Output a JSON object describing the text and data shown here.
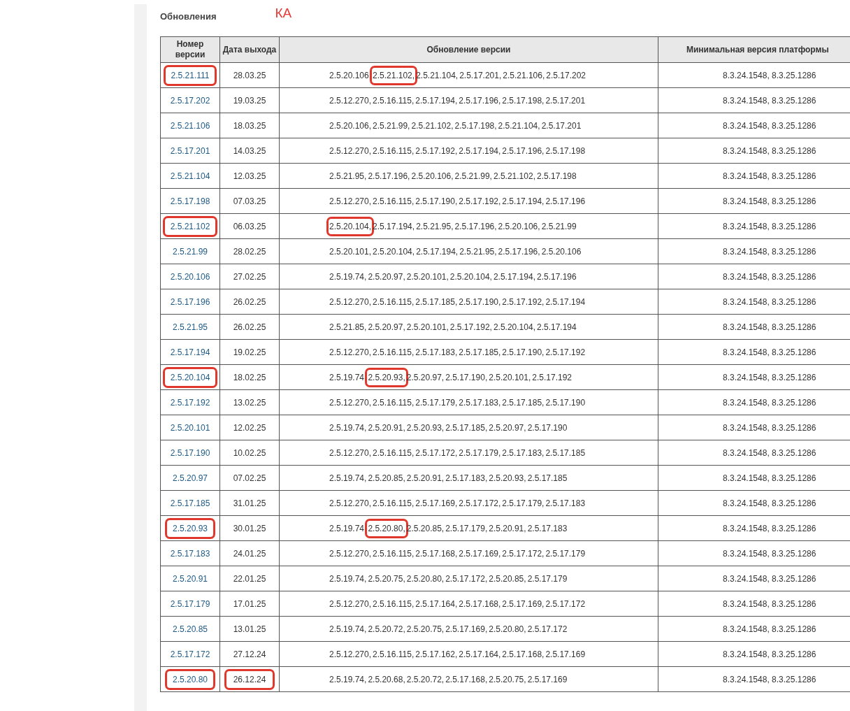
{
  "heading": "Обновления",
  "annotation": "КА",
  "table": {
    "columns": [
      "Номер версии",
      "Дата выхода",
      "Обновление версии",
      "Минимальная версия платформы"
    ],
    "update_separator": ",",
    "rows": [
      {
        "version": "2.5.21.111",
        "version_marked": true,
        "date": "28.03.25",
        "date_marked": false,
        "updates": [
          {
            "v": "2.5.20.106",
            "marked": false
          },
          {
            "v": "2.5.21.102",
            "marked": true
          },
          {
            "v": "2.5.21.104",
            "marked": false
          },
          {
            "v": "2.5.17.201",
            "marked": false
          },
          {
            "v": "2.5.21.106",
            "marked": false
          },
          {
            "v": "2.5.17.202",
            "marked": false
          }
        ],
        "platform": "8.3.24.1548, 8.3.25.1286"
      },
      {
        "version": "2.5.17.202",
        "version_marked": false,
        "date": "19.03.25",
        "date_marked": false,
        "updates": [
          {
            "v": "2.5.12.270",
            "marked": false
          },
          {
            "v": "2.5.16.115",
            "marked": false
          },
          {
            "v": "2.5.17.194",
            "marked": false
          },
          {
            "v": "2.5.17.196",
            "marked": false
          },
          {
            "v": "2.5.17.198",
            "marked": false
          },
          {
            "v": "2.5.17.201",
            "marked": false
          }
        ],
        "platform": "8.3.24.1548, 8.3.25.1286"
      },
      {
        "version": "2.5.21.106",
        "version_marked": false,
        "date": "18.03.25",
        "date_marked": false,
        "updates": [
          {
            "v": "2.5.20.106",
            "marked": false
          },
          {
            "v": "2.5.21.99",
            "marked": false
          },
          {
            "v": "2.5.21.102",
            "marked": false
          },
          {
            "v": "2.5.17.198",
            "marked": false
          },
          {
            "v": "2.5.21.104",
            "marked": false
          },
          {
            "v": "2.5.17.201",
            "marked": false
          }
        ],
        "platform": "8.3.24.1548, 8.3.25.1286"
      },
      {
        "version": "2.5.17.201",
        "version_marked": false,
        "date": "14.03.25",
        "date_marked": false,
        "updates": [
          {
            "v": "2.5.12.270",
            "marked": false
          },
          {
            "v": "2.5.16.115",
            "marked": false
          },
          {
            "v": "2.5.17.192",
            "marked": false
          },
          {
            "v": "2.5.17.194",
            "marked": false
          },
          {
            "v": "2.5.17.196",
            "marked": false
          },
          {
            "v": "2.5.17.198",
            "marked": false
          }
        ],
        "platform": "8.3.24.1548, 8.3.25.1286"
      },
      {
        "version": "2.5.21.104",
        "version_marked": false,
        "date": "12.03.25",
        "date_marked": false,
        "updates": [
          {
            "v": "2.5.21.95",
            "marked": false
          },
          {
            "v": "2.5.17.196",
            "marked": false
          },
          {
            "v": "2.5.20.106",
            "marked": false
          },
          {
            "v": "2.5.21.99",
            "marked": false
          },
          {
            "v": "2.5.21.102",
            "marked": false
          },
          {
            "v": "2.5.17.198",
            "marked": false
          }
        ],
        "platform": "8.3.24.1548, 8.3.25.1286"
      },
      {
        "version": "2.5.17.198",
        "version_marked": false,
        "date": "07.03.25",
        "date_marked": false,
        "updates": [
          {
            "v": "2.5.12.270",
            "marked": false
          },
          {
            "v": "2.5.16.115",
            "marked": false
          },
          {
            "v": "2.5.17.190",
            "marked": false
          },
          {
            "v": "2.5.17.192",
            "marked": false
          },
          {
            "v": "2.5.17.194",
            "marked": false
          },
          {
            "v": "2.5.17.196",
            "marked": false
          }
        ],
        "platform": "8.3.24.1548, 8.3.25.1286"
      },
      {
        "version": "2.5.21.102",
        "version_marked": true,
        "date": "06.03.25",
        "date_marked": false,
        "updates": [
          {
            "v": "2.5.20.104",
            "marked": true
          },
          {
            "v": "2.5.17.194",
            "marked": false
          },
          {
            "v": "2.5.21.95",
            "marked": false
          },
          {
            "v": "2.5.17.196",
            "marked": false
          },
          {
            "v": "2.5.20.106",
            "marked": false
          },
          {
            "v": "2.5.21.99",
            "marked": false
          }
        ],
        "platform": "8.3.24.1548, 8.3.25.1286"
      },
      {
        "version": "2.5.21.99",
        "version_marked": false,
        "date": "28.02.25",
        "date_marked": false,
        "updates": [
          {
            "v": "2.5.20.101",
            "marked": false
          },
          {
            "v": "2.5.20.104",
            "marked": false
          },
          {
            "v": "2.5.17.194",
            "marked": false
          },
          {
            "v": "2.5.21.95",
            "marked": false
          },
          {
            "v": "2.5.17.196",
            "marked": false
          },
          {
            "v": "2.5.20.106",
            "marked": false
          }
        ],
        "platform": "8.3.24.1548, 8.3.25.1286"
      },
      {
        "version": "2.5.20.106",
        "version_marked": false,
        "date": "27.02.25",
        "date_marked": false,
        "updates": [
          {
            "v": "2.5.19.74",
            "marked": false
          },
          {
            "v": "2.5.20.97",
            "marked": false
          },
          {
            "v": "2.5.20.101",
            "marked": false
          },
          {
            "v": "2.5.20.104",
            "marked": false
          },
          {
            "v": "2.5.17.194",
            "marked": false
          },
          {
            "v": "2.5.17.196",
            "marked": false
          }
        ],
        "platform": "8.3.24.1548, 8.3.25.1286"
      },
      {
        "version": "2.5.17.196",
        "version_marked": false,
        "date": "26.02.25",
        "date_marked": false,
        "updates": [
          {
            "v": "2.5.12.270",
            "marked": false
          },
          {
            "v": "2.5.16.115",
            "marked": false
          },
          {
            "v": "2.5.17.185",
            "marked": false
          },
          {
            "v": "2.5.17.190",
            "marked": false
          },
          {
            "v": "2.5.17.192",
            "marked": false
          },
          {
            "v": "2.5.17.194",
            "marked": false
          }
        ],
        "platform": "8.3.24.1548, 8.3.25.1286"
      },
      {
        "version": "2.5.21.95",
        "version_marked": false,
        "date": "26.02.25",
        "date_marked": false,
        "updates": [
          {
            "v": "2.5.21.85",
            "marked": false
          },
          {
            "v": "2.5.20.97",
            "marked": false
          },
          {
            "v": "2.5.20.101",
            "marked": false
          },
          {
            "v": "2.5.17.192",
            "marked": false
          },
          {
            "v": "2.5.20.104",
            "marked": false
          },
          {
            "v": "2.5.17.194",
            "marked": false
          }
        ],
        "platform": "8.3.24.1548, 8.3.25.1286"
      },
      {
        "version": "2.5.17.194",
        "version_marked": false,
        "date": "19.02.25",
        "date_marked": false,
        "updates": [
          {
            "v": "2.5.12.270",
            "marked": false
          },
          {
            "v": "2.5.16.115",
            "marked": false
          },
          {
            "v": "2.5.17.183",
            "marked": false
          },
          {
            "v": "2.5.17.185",
            "marked": false
          },
          {
            "v": "2.5.17.190",
            "marked": false
          },
          {
            "v": "2.5.17.192",
            "marked": false
          }
        ],
        "platform": "8.3.24.1548, 8.3.25.1286"
      },
      {
        "version": "2.5.20.104",
        "version_marked": true,
        "date": "18.02.25",
        "date_marked": false,
        "updates": [
          {
            "v": "2.5.19.74",
            "marked": false
          },
          {
            "v": "2.5.20.93",
            "marked": true
          },
          {
            "v": "2.5.20.97",
            "marked": false
          },
          {
            "v": "2.5.17.190",
            "marked": false
          },
          {
            "v": "2.5.20.101",
            "marked": false
          },
          {
            "v": "2.5.17.192",
            "marked": false
          }
        ],
        "platform": "8.3.24.1548, 8.3.25.1286"
      },
      {
        "version": "2.5.17.192",
        "version_marked": false,
        "date": "13.02.25",
        "date_marked": false,
        "updates": [
          {
            "v": "2.5.12.270",
            "marked": false
          },
          {
            "v": "2.5.16.115",
            "marked": false
          },
          {
            "v": "2.5.17.179",
            "marked": false
          },
          {
            "v": "2.5.17.183",
            "marked": false
          },
          {
            "v": "2.5.17.185",
            "marked": false
          },
          {
            "v": "2.5.17.190",
            "marked": false
          }
        ],
        "platform": "8.3.24.1548, 8.3.25.1286"
      },
      {
        "version": "2.5.20.101",
        "version_marked": false,
        "date": "12.02.25",
        "date_marked": false,
        "updates": [
          {
            "v": "2.5.19.74",
            "marked": false
          },
          {
            "v": "2.5.20.91",
            "marked": false
          },
          {
            "v": "2.5.20.93",
            "marked": false
          },
          {
            "v": "2.5.17.185",
            "marked": false
          },
          {
            "v": "2.5.20.97",
            "marked": false
          },
          {
            "v": "2.5.17.190",
            "marked": false
          }
        ],
        "platform": "8.3.24.1548, 8.3.25.1286"
      },
      {
        "version": "2.5.17.190",
        "version_marked": false,
        "date": "10.02.25",
        "date_marked": false,
        "updates": [
          {
            "v": "2.5.12.270",
            "marked": false
          },
          {
            "v": "2.5.16.115",
            "marked": false
          },
          {
            "v": "2.5.17.172",
            "marked": false
          },
          {
            "v": "2.5.17.179",
            "marked": false
          },
          {
            "v": "2.5.17.183",
            "marked": false
          },
          {
            "v": "2.5.17.185",
            "marked": false
          }
        ],
        "platform": "8.3.24.1548, 8.3.25.1286"
      },
      {
        "version": "2.5.20.97",
        "version_marked": false,
        "date": "07.02.25",
        "date_marked": false,
        "updates": [
          {
            "v": "2.5.19.74",
            "marked": false
          },
          {
            "v": "2.5.20.85",
            "marked": false
          },
          {
            "v": "2.5.20.91",
            "marked": false
          },
          {
            "v": "2.5.17.183",
            "marked": false
          },
          {
            "v": "2.5.20.93",
            "marked": false
          },
          {
            "v": "2.5.17.185",
            "marked": false
          }
        ],
        "platform": "8.3.24.1548, 8.3.25.1286"
      },
      {
        "version": "2.5.17.185",
        "version_marked": false,
        "date": "31.01.25",
        "date_marked": false,
        "updates": [
          {
            "v": "2.5.12.270",
            "marked": false
          },
          {
            "v": "2.5.16.115",
            "marked": false
          },
          {
            "v": "2.5.17.169",
            "marked": false
          },
          {
            "v": "2.5.17.172",
            "marked": false
          },
          {
            "v": "2.5.17.179",
            "marked": false
          },
          {
            "v": "2.5.17.183",
            "marked": false
          }
        ],
        "platform": "8.3.24.1548, 8.3.25.1286"
      },
      {
        "version": "2.5.20.93",
        "version_marked": true,
        "date": "30.01.25",
        "date_marked": false,
        "updates": [
          {
            "v": "2.5.19.74",
            "marked": false
          },
          {
            "v": "2.5.20.80",
            "marked": true
          },
          {
            "v": "2.5.20.85",
            "marked": false
          },
          {
            "v": "2.5.17.179",
            "marked": false
          },
          {
            "v": "2.5.20.91",
            "marked": false
          },
          {
            "v": "2.5.17.183",
            "marked": false
          }
        ],
        "platform": "8.3.24.1548, 8.3.25.1286"
      },
      {
        "version": "2.5.17.183",
        "version_marked": false,
        "date": "24.01.25",
        "date_marked": false,
        "updates": [
          {
            "v": "2.5.12.270",
            "marked": false
          },
          {
            "v": "2.5.16.115",
            "marked": false
          },
          {
            "v": "2.5.17.168",
            "marked": false
          },
          {
            "v": "2.5.17.169",
            "marked": false
          },
          {
            "v": "2.5.17.172",
            "marked": false
          },
          {
            "v": "2.5.17.179",
            "marked": false
          }
        ],
        "platform": "8.3.24.1548, 8.3.25.1286"
      },
      {
        "version": "2.5.20.91",
        "version_marked": false,
        "date": "22.01.25",
        "date_marked": false,
        "updates": [
          {
            "v": "2.5.19.74",
            "marked": false
          },
          {
            "v": "2.5.20.75",
            "marked": false
          },
          {
            "v": "2.5.20.80",
            "marked": false
          },
          {
            "v": "2.5.17.172",
            "marked": false
          },
          {
            "v": "2.5.20.85",
            "marked": false
          },
          {
            "v": "2.5.17.179",
            "marked": false
          }
        ],
        "platform": "8.3.24.1548, 8.3.25.1286"
      },
      {
        "version": "2.5.17.179",
        "version_marked": false,
        "date": "17.01.25",
        "date_marked": false,
        "updates": [
          {
            "v": "2.5.12.270",
            "marked": false
          },
          {
            "v": "2.5.16.115",
            "marked": false
          },
          {
            "v": "2.5.17.164",
            "marked": false
          },
          {
            "v": "2.5.17.168",
            "marked": false
          },
          {
            "v": "2.5.17.169",
            "marked": false
          },
          {
            "v": "2.5.17.172",
            "marked": false
          }
        ],
        "platform": "8.3.24.1548, 8.3.25.1286"
      },
      {
        "version": "2.5.20.85",
        "version_marked": false,
        "date": "13.01.25",
        "date_marked": false,
        "updates": [
          {
            "v": "2.5.19.74",
            "marked": false
          },
          {
            "v": "2.5.20.72",
            "marked": false
          },
          {
            "v": "2.5.20.75",
            "marked": false
          },
          {
            "v": "2.5.17.169",
            "marked": false
          },
          {
            "v": "2.5.20.80",
            "marked": false
          },
          {
            "v": "2.5.17.172",
            "marked": false
          }
        ],
        "platform": "8.3.24.1548, 8.3.25.1286"
      },
      {
        "version": "2.5.17.172",
        "version_marked": false,
        "date": "27.12.24",
        "date_marked": false,
        "updates": [
          {
            "v": "2.5.12.270",
            "marked": false
          },
          {
            "v": "2.5.16.115",
            "marked": false
          },
          {
            "v": "2.5.17.162",
            "marked": false
          },
          {
            "v": "2.5.17.164",
            "marked": false
          },
          {
            "v": "2.5.17.168",
            "marked": false
          },
          {
            "v": "2.5.17.169",
            "marked": false
          }
        ],
        "platform": "8.3.24.1548, 8.3.25.1286"
      },
      {
        "version": "2.5.20.80",
        "version_marked": true,
        "date": "26.12.24",
        "date_marked": true,
        "updates": [
          {
            "v": "2.5.19.74",
            "marked": false
          },
          {
            "v": "2.5.20.68",
            "marked": false
          },
          {
            "v": "2.5.20.72",
            "marked": false
          },
          {
            "v": "2.5.17.168",
            "marked": false
          },
          {
            "v": "2.5.20.75",
            "marked": false
          },
          {
            "v": "2.5.17.169",
            "marked": false
          }
        ],
        "platform": "8.3.24.1548, 8.3.25.1286"
      }
    ]
  }
}
